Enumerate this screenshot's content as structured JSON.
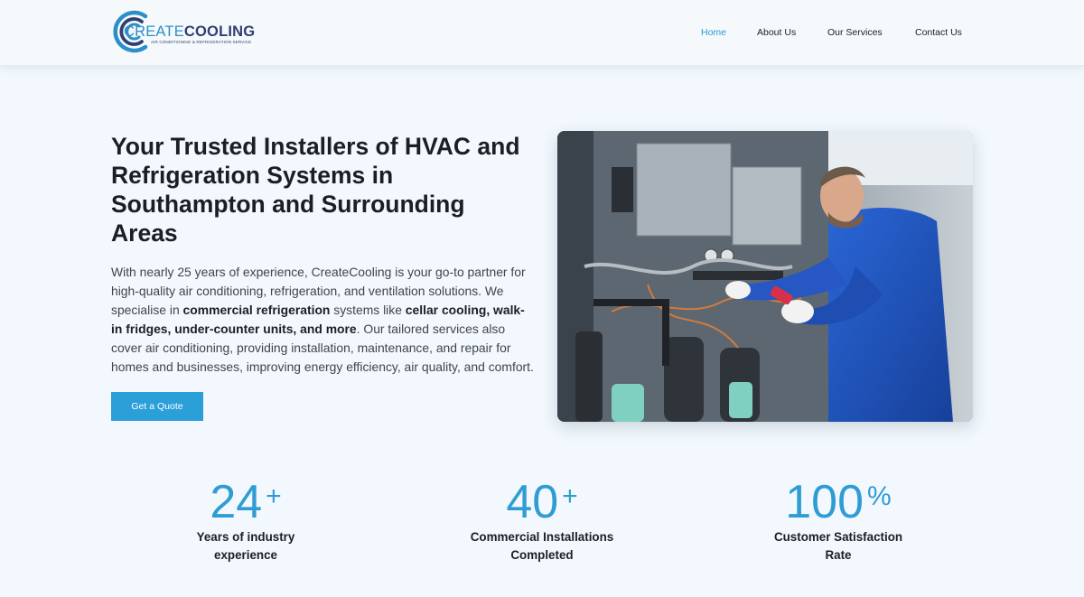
{
  "brand": {
    "name_part1": "CREATE",
    "name_part2": "COOLING",
    "tagline": "AIR CONDITIONING & REFRIGERATION SERVICE",
    "primary_color": "#2b9fd8",
    "navy_color": "#2f3f73"
  },
  "nav": {
    "items": [
      {
        "label": "Home",
        "active": true
      },
      {
        "label": "About Us",
        "active": false
      },
      {
        "label": "Our Services",
        "active": false
      },
      {
        "label": "Contact Us",
        "active": false
      }
    ]
  },
  "hero": {
    "title": "Your Trusted Installers of HVAC and Refrigeration Systems in Southampton and Surrounding Areas",
    "body_1": "With nearly 25 years of experience, CreateCooling is your go-to partner for high-quality air conditioning, refrigeration, and ventilation solutions. We specialise in ",
    "body_bold_1": "commercial refrigeration",
    "body_2": " systems like ",
    "body_bold_2": "cellar cooling, walk-in fridges, under-counter units, and more",
    "body_3": ". Our tailored services also cover air conditioning, providing installation, maintenance, and repair for homes and businesses, improving energy efficiency, air quality, and comfort.",
    "cta_label": "Get a Quote",
    "image_icon": "technician-hvac-unit-photo"
  },
  "stats": [
    {
      "value": "24",
      "suffix": "+",
      "label": "Years of industry experience"
    },
    {
      "value": "40",
      "suffix": "+",
      "label": "Commercial Installations Completed"
    },
    {
      "value": "100",
      "suffix": "%",
      "label": "Customer Satisfaction Rate"
    }
  ]
}
